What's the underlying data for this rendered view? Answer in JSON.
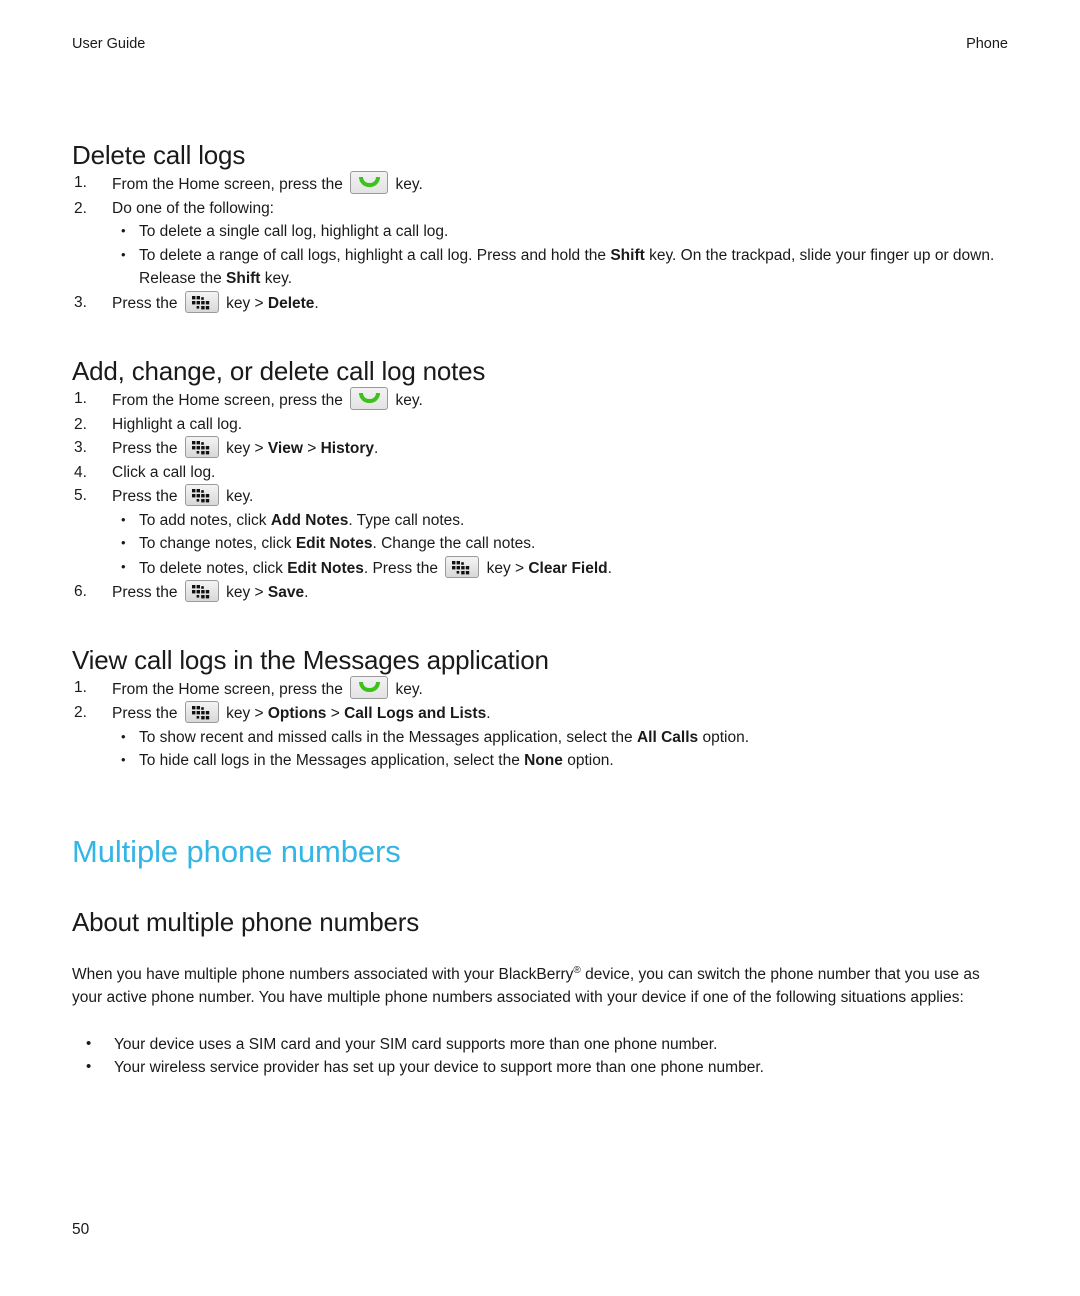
{
  "running_head": {
    "left": "User Guide",
    "right": "Phone"
  },
  "colors": {
    "chapter_heading": "#33B5E5",
    "body_text": "#1a1a1a",
    "send_key_green": "#3cc21a",
    "key_border": "#9a9a9a"
  },
  "icons": {
    "send_key": "send-call-key-icon",
    "menu_key": "blackberry-menu-key-icon"
  },
  "sections": [
    {
      "id": "delete-call-logs",
      "heading": "Delete call logs",
      "steps": [
        {
          "num": "1.",
          "parts": [
            {
              "t": "text",
              "v": "From the Home screen, press the "
            },
            {
              "t": "key",
              "v": "send"
            },
            {
              "t": "text",
              "v": " key."
            }
          ]
        },
        {
          "num": "2.",
          "parts": [
            {
              "t": "text",
              "v": "Do one of the following:"
            }
          ],
          "bullets": [
            [
              {
                "t": "text",
                "v": "To delete a single call log, highlight a call log."
              }
            ],
            [
              {
                "t": "text",
                "v": "To delete a range of call logs, highlight a call log. Press and hold the "
              },
              {
                "t": "bold",
                "v": "Shift"
              },
              {
                "t": "text",
                "v": " key. On the trackpad, slide your finger up or down. Release the "
              },
              {
                "t": "bold",
                "v": "Shift"
              },
              {
                "t": "text",
                "v": " key."
              }
            ]
          ]
        },
        {
          "num": "3.",
          "parts": [
            {
              "t": "text",
              "v": "Press the "
            },
            {
              "t": "key",
              "v": "menu"
            },
            {
              "t": "text",
              "v": " key > "
            },
            {
              "t": "bold",
              "v": "Delete"
            },
            {
              "t": "text",
              "v": "."
            }
          ]
        }
      ]
    },
    {
      "id": "add-change-delete-call-log-notes",
      "heading": "Add, change, or delete call log notes",
      "steps": [
        {
          "num": "1.",
          "parts": [
            {
              "t": "text",
              "v": "From the Home screen, press the "
            },
            {
              "t": "key",
              "v": "send"
            },
            {
              "t": "text",
              "v": " key."
            }
          ]
        },
        {
          "num": "2.",
          "parts": [
            {
              "t": "text",
              "v": "Highlight a call log."
            }
          ]
        },
        {
          "num": "3.",
          "parts": [
            {
              "t": "text",
              "v": "Press the "
            },
            {
              "t": "key",
              "v": "menu"
            },
            {
              "t": "text",
              "v": " key > "
            },
            {
              "t": "bold",
              "v": "View"
            },
            {
              "t": "text",
              "v": " > "
            },
            {
              "t": "bold",
              "v": "History"
            },
            {
              "t": "text",
              "v": "."
            }
          ]
        },
        {
          "num": "4.",
          "parts": [
            {
              "t": "text",
              "v": "Click a call log."
            }
          ]
        },
        {
          "num": "5.",
          "parts": [
            {
              "t": "text",
              "v": "Press the "
            },
            {
              "t": "key",
              "v": "menu"
            },
            {
              "t": "text",
              "v": " key."
            }
          ],
          "bullets": [
            [
              {
                "t": "text",
                "v": "To add notes, click "
              },
              {
                "t": "bold",
                "v": "Add Notes"
              },
              {
                "t": "text",
                "v": ". Type call notes."
              }
            ],
            [
              {
                "t": "text",
                "v": "To change notes, click "
              },
              {
                "t": "bold",
                "v": "Edit Notes"
              },
              {
                "t": "text",
                "v": ". Change the call notes."
              }
            ],
            [
              {
                "t": "text",
                "v": "To delete notes, click "
              },
              {
                "t": "bold",
                "v": "Edit Notes"
              },
              {
                "t": "text",
                "v": ". Press the "
              },
              {
                "t": "key",
                "v": "menu"
              },
              {
                "t": "text",
                "v": " key > "
              },
              {
                "t": "bold",
                "v": "Clear Field"
              },
              {
                "t": "text",
                "v": "."
              }
            ]
          ]
        },
        {
          "num": "6.",
          "parts": [
            {
              "t": "text",
              "v": "Press the "
            },
            {
              "t": "key",
              "v": "menu"
            },
            {
              "t": "text",
              "v": " key > "
            },
            {
              "t": "bold",
              "v": "Save"
            },
            {
              "t": "text",
              "v": "."
            }
          ]
        }
      ]
    },
    {
      "id": "view-call-logs-in-messages",
      "heading": "View call logs in the Messages application",
      "steps": [
        {
          "num": "1.",
          "parts": [
            {
              "t": "text",
              "v": "From the Home screen, press the "
            },
            {
              "t": "key",
              "v": "send"
            },
            {
              "t": "text",
              "v": " key."
            }
          ]
        },
        {
          "num": "2.",
          "parts": [
            {
              "t": "text",
              "v": "Press the "
            },
            {
              "t": "key",
              "v": "menu"
            },
            {
              "t": "text",
              "v": " key > "
            },
            {
              "t": "bold",
              "v": "Options"
            },
            {
              "t": "text",
              "v": " > "
            },
            {
              "t": "bold",
              "v": "Call Logs and Lists"
            },
            {
              "t": "text",
              "v": "."
            }
          ],
          "bullets": [
            [
              {
                "t": "text",
                "v": "To show recent and missed calls in the Messages application, select the "
              },
              {
                "t": "bold",
                "v": "All Calls"
              },
              {
                "t": "text",
                "v": " option."
              }
            ],
            [
              {
                "t": "text",
                "v": "To hide call logs in the Messages application, select the "
              },
              {
                "t": "bold",
                "v": "None"
              },
              {
                "t": "text",
                "v": " option."
              }
            ]
          ]
        }
      ]
    }
  ],
  "chapter": {
    "title": "Multiple phone numbers",
    "subsection_heading": "About multiple phone numbers",
    "paragraph_parts": [
      {
        "t": "text",
        "v": "When you have multiple phone numbers associated with your BlackBerry"
      },
      {
        "t": "sup",
        "v": "®"
      },
      {
        "t": "text",
        "v": " device, you can switch the phone number that you use as your active phone number. You have multiple phone numbers associated with your device if one of the following situations applies:"
      }
    ],
    "bullets": [
      [
        {
          "t": "text",
          "v": "Your device uses a SIM card and your SIM card supports more than one phone number."
        }
      ],
      [
        {
          "t": "text",
          "v": "Your wireless service provider has set up your device to support more than one phone number."
        }
      ]
    ]
  },
  "folio": "50"
}
